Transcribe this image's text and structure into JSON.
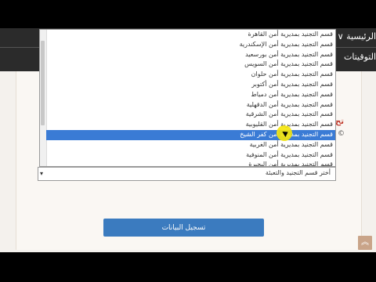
{
  "header": {
    "nav_home": "الرئيسية ∨",
    "nav_times": "التوقيتات"
  },
  "form": {
    "red_label": "تح",
    "side_glyph": "©",
    "select_value": "أختر قسم التجنيد والتعبئة",
    "submit_label": "تسجيل البيانات"
  },
  "dropdown": {
    "selected_index": 11,
    "items": [
      "قسم التجنيد بمديرية أمن القاهرة",
      "قسم التجنيد بمديرية أمن الإسكندرية",
      "قسم التجنيد بمديرية أمن بورسعيد",
      "قسم التجنيد بمديرية أمن السويس",
      "قسم التجنيد بمديرية أمن حلوان",
      "قسم التجنيد بمديرية أمن أكتوبر",
      "قسم التجنيد بمديرية أمن دمياط",
      "قسم التجنيد بمديرية أمن الدقهلية",
      "قسم التجنيد بمديرية أمن الشرقية",
      "قسم التجنيد بمديرية أمن القليوبية",
      "قسم التجنيد بمديرية أمن كفر الشيخ",
      "قسم التجنيد بمديرية أمن الغربية",
      "قسم التجنيد بمديرية أمن المنوفية",
      "قسم التجنيد بمديرية أمن البحيرة"
    ]
  },
  "scroll_top": {
    "icon": "chevron-double-up-icon",
    "glyph": "︽"
  },
  "colors": {
    "selection": "#3a7bd5",
    "button": "#3b7bbf",
    "accent_red": "#c0392b",
    "header": "#2b2b2b",
    "scroll_top": "#c9a489"
  }
}
